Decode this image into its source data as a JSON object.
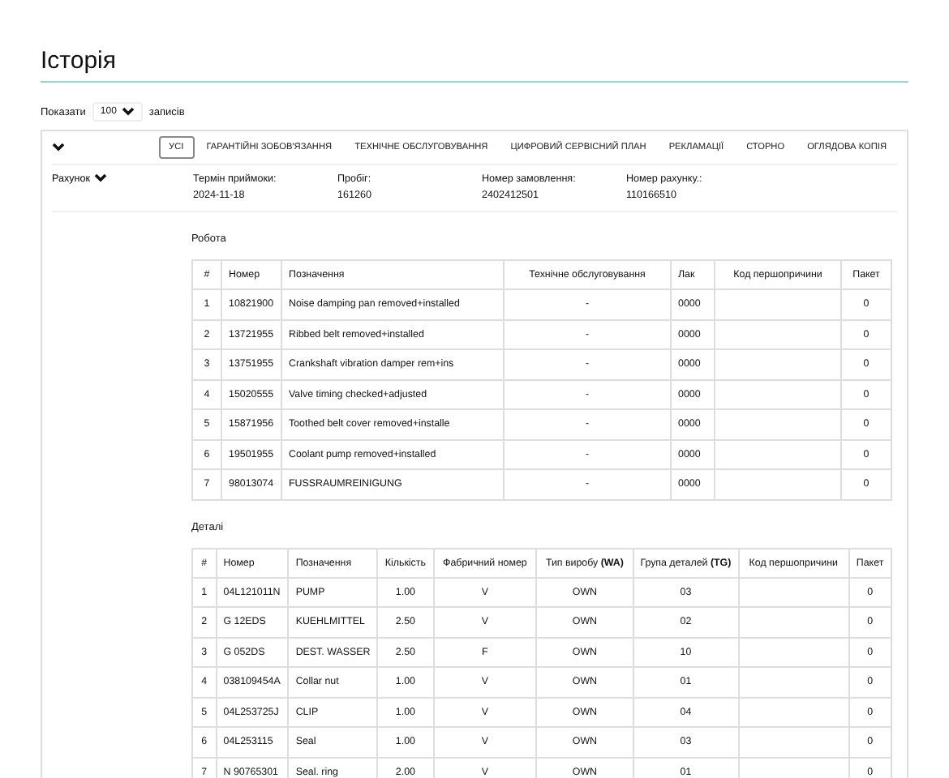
{
  "title": "Історія",
  "length_control": {
    "before": "Показати",
    "value": "100",
    "after": "записів"
  },
  "tabs": [
    {
      "label": "УСІ",
      "selected": true
    },
    {
      "label": "ГАРАНТІЙНІ ЗОБОВ'ЯЗАННЯ",
      "selected": false
    },
    {
      "label": "ТЕХНІЧНЕ ОБСЛУГОВУВАННЯ",
      "selected": false
    },
    {
      "label": "ЦИФРОВИЙ СЕРВІСНИЙ ПЛАН",
      "selected": false
    },
    {
      "label": "РЕКЛАМАЦІЇ",
      "selected": false
    },
    {
      "label": "СТОРНО",
      "selected": false
    },
    {
      "label": "ОГЛЯДОВА КОПІЯ",
      "selected": false
    }
  ],
  "invoice": {
    "label": "Рахунок",
    "fields": [
      {
        "label": "Термін приймоки:",
        "value": "2024-11-18"
      },
      {
        "label": "Пробіг:",
        "value": "161260"
      },
      {
        "label": "Номер замовлення:",
        "value": "2402412501"
      },
      {
        "label": "Номер рахунку.:",
        "value": "110166510"
      }
    ]
  },
  "work": {
    "heading": "Робота",
    "columns": [
      "#",
      "Номер",
      "Позначення",
      "Технічне обслуговування",
      "Лак",
      "Код першопричини",
      "Пакет"
    ],
    "rows": [
      [
        "1",
        "10821900",
        "Noise damping pan removed+installed",
        "-",
        "0000",
        "",
        "0"
      ],
      [
        "2",
        "13721955",
        "Ribbed belt removed+installed",
        "-",
        "0000",
        "",
        "0"
      ],
      [
        "3",
        "13751955",
        "Crankshaft vibration damper rem+ins",
        "-",
        "0000",
        "",
        "0"
      ],
      [
        "4",
        "15020555",
        "Valve timing checked+adjusted",
        "-",
        "0000",
        "",
        "0"
      ],
      [
        "5",
        "15871956",
        "Toothed belt cover removed+installe",
        "-",
        "0000",
        "",
        "0"
      ],
      [
        "6",
        "19501955",
        "Coolant pump removed+installed",
        "-",
        "0000",
        "",
        "0"
      ],
      [
        "7",
        "98013074",
        "FUSSRAUMREINIGUNG",
        "-",
        "0000",
        "",
        "0"
      ]
    ]
  },
  "parts": {
    "heading": "Деталі",
    "columns": [
      "#",
      "Номер",
      "Позначення",
      "Кількість",
      "Фабричний номер",
      "Тип виробу **(WA)**",
      "Група деталей **(TG)**",
      "Код першопричини",
      "Пакет"
    ],
    "rows": [
      [
        "1",
        "04L121011N",
        "PUMP",
        "1.00",
        "V",
        "OWN",
        "03",
        "",
        "0"
      ],
      [
        "2",
        "G 12EDS",
        "KUEHLMITTEL",
        "2.50",
        "V",
        "OWN",
        "02",
        "",
        "0"
      ],
      [
        "3",
        "G 052DS",
        "DEST. WASSER",
        "2.50",
        "F",
        "OWN",
        "10",
        "",
        "0"
      ],
      [
        "4",
        "038109454A",
        "Collar nut",
        "1.00",
        "V",
        "OWN",
        "01",
        "",
        "0"
      ],
      [
        "5",
        "04L253725J",
        "CLIP",
        "1.00",
        "V",
        "OWN",
        "04",
        "",
        "0"
      ],
      [
        "6",
        "04L253115",
        "Seal",
        "1.00",
        "V",
        "OWN",
        "03",
        "",
        "0"
      ],
      [
        "7",
        "N 90765301",
        "Seal. ring",
        "2.00",
        "V",
        "OWN",
        "01",
        "",
        "0"
      ]
    ]
  }
}
